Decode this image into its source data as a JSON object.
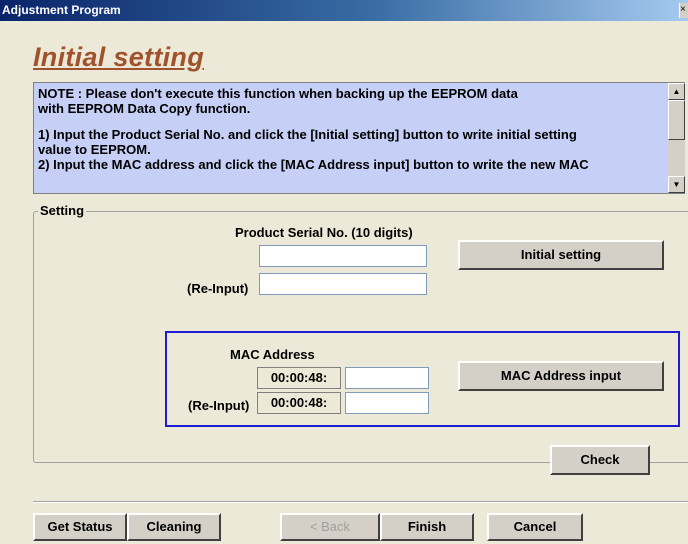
{
  "window": {
    "title": "Adjustment Program"
  },
  "page": {
    "heading": "Initial setting"
  },
  "note": {
    "lines": [
      "NOTE : Please don't execute this function when backing up the EEPROM data",
      "with EEPROM Data Copy function.",
      "",
      "1) Input the Product Serial No. and click the [Initial setting] button to write initial setting",
      "value to EEPROM.",
      "2) Input the MAC address and click the [MAC Address input] button to write the new MAC"
    ]
  },
  "setting": {
    "group_label": "Setting",
    "serial_label": "Product Serial No. (10 digits)",
    "serial_value": "",
    "reinput_label": "(Re-Input)",
    "serial_reinput_value": "",
    "initial_setting_button": "Initial setting",
    "mac_label": "MAC Address",
    "mac_prefix": "00:00:48:",
    "mac_value": "",
    "mac_reinput_label": "(Re-Input)",
    "mac_reinput_prefix": "00:00:48:",
    "mac_reinput_value": "",
    "mac_input_button": "MAC Address input",
    "check_button": "Check"
  },
  "footer": {
    "get_status": "Get Status",
    "cleaning": "Cleaning",
    "back": "< Back",
    "finish": "Finish",
    "cancel": "Cancel"
  },
  "colors": {
    "heading": "#A0522D",
    "note_background": "#C6D0F7",
    "highlight_border": "#1C1CD0",
    "window_background": "#ECE9D8"
  }
}
